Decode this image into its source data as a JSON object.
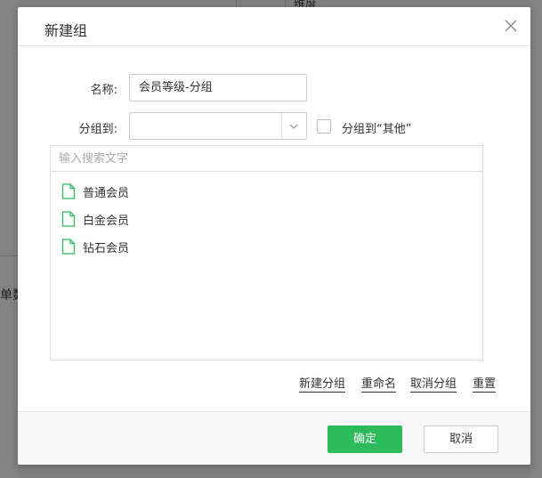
{
  "background": {
    "fragment_top": "维度",
    "fragment_left": "单数"
  },
  "dialog": {
    "title": "新建组",
    "name_label": "名称:",
    "name_value": "会员等级-分组",
    "group_to_label": "分组到:",
    "group_to_value": "",
    "group_to_other_label": "分组到“其他”",
    "group_to_other_checked": false,
    "search_placeholder": "输入搜索文字",
    "items": [
      {
        "label": "普通会员",
        "icon": "file-icon"
      },
      {
        "label": "白金会员",
        "icon": "file-icon"
      },
      {
        "label": "钻石会员",
        "icon": "file-icon"
      }
    ],
    "actions": {
      "new_group": "新建分组",
      "rename": "重命名",
      "ungroup": "取消分组",
      "reset": "重置"
    },
    "confirm_label": "确定",
    "cancel_label": "取消",
    "colors": {
      "primary": "#2dbb5c",
      "icon_green": "#2dbb5c",
      "overlay": "#7f7f7f"
    }
  }
}
